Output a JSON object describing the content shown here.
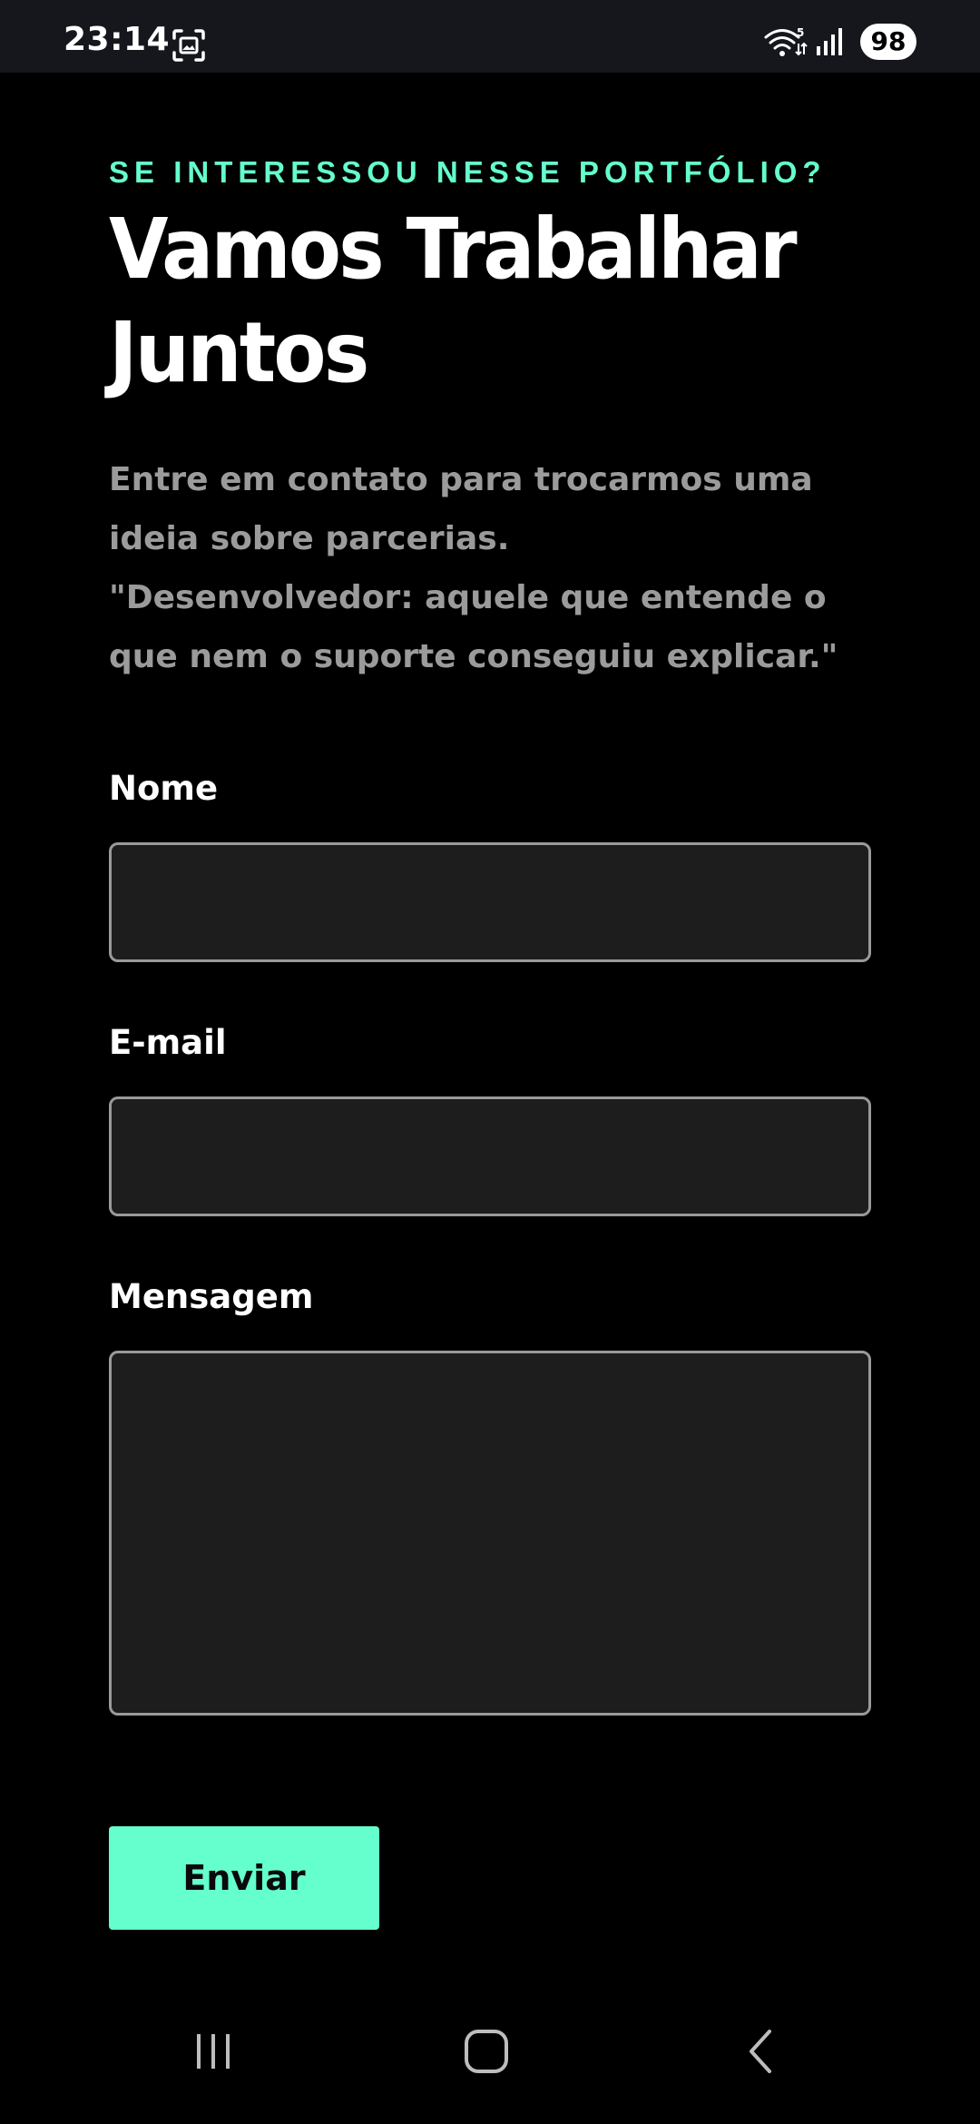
{
  "status_bar": {
    "time": "23:14",
    "battery": "98",
    "icons": [
      "screenshot-icon",
      "wifi-icon",
      "signal-icon"
    ]
  },
  "hero": {
    "eyebrow": "SE INTERESSOU NESSE PORTFÓLIO?",
    "headline_line1": "Vamos Trabalhar",
    "headline_line2": "Juntos",
    "intro_line1": "Entre em contato para trocarmos uma ideia sobre parcerias.",
    "intro_line2": "\"Desenvolvedor: aquele que entende o que nem o suporte conseguiu explicar.\""
  },
  "form": {
    "name_label": "Nome",
    "name_value": "",
    "email_label": "E-mail",
    "email_value": "",
    "message_label": "Mensagem",
    "message_value": "",
    "submit_label": "Enviar"
  },
  "nav_bar": {
    "icons": [
      "recent-apps-icon",
      "home-icon",
      "back-icon"
    ]
  },
  "colors": {
    "accent": "#64ffcc",
    "background": "#000000",
    "input_background": "#1d1d1d",
    "input_border": "#9a9a9a",
    "muted_text": "#9b9b9b"
  }
}
